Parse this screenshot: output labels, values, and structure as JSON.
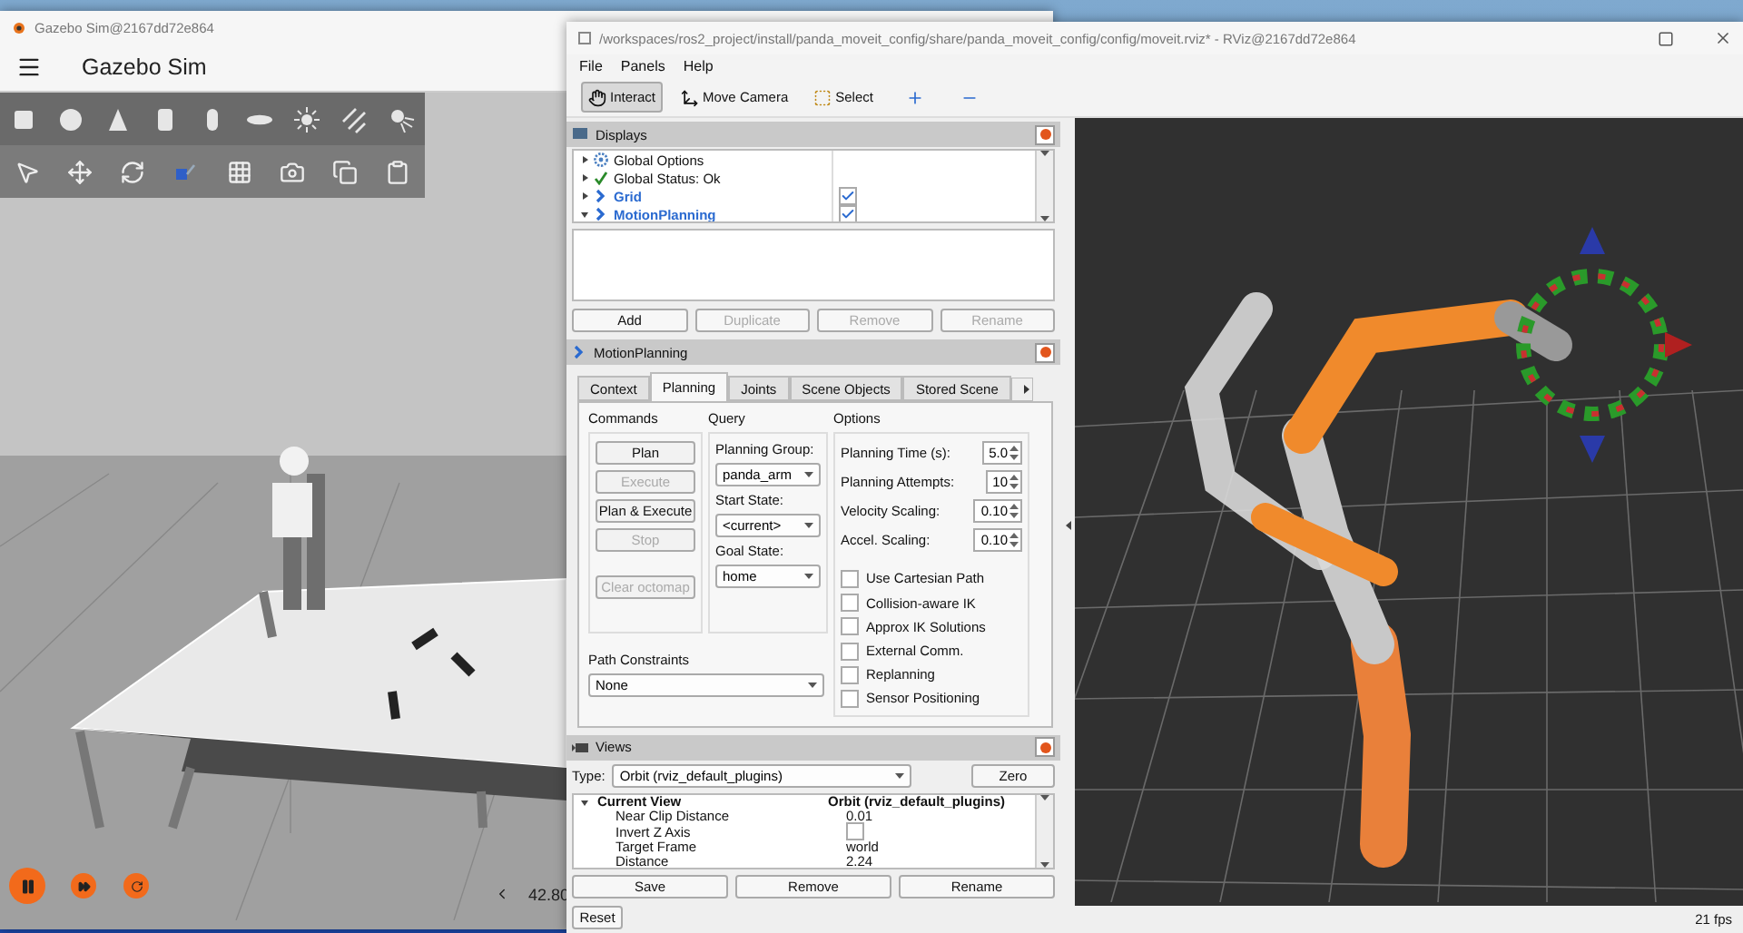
{
  "gazebo": {
    "window_title": "Gazebo Sim@2167dd72e864",
    "app_title": "Gazebo Sim",
    "playing": true,
    "sim_time": "42.80"
  },
  "rviz": {
    "window_title": "/workspaces/ros2_project/install/panda_moveit_config/share/panda_moveit_config/config/moveit.rviz* - RViz@2167dd72e864",
    "menu": [
      "File",
      "Panels",
      "Help"
    ],
    "tools": [
      {
        "label": "Interact",
        "kind": "interact",
        "selected": true
      },
      {
        "label": "Move Camera",
        "kind": "camera",
        "selected": false
      },
      {
        "label": "Select",
        "kind": "select",
        "selected": false
      }
    ],
    "displays": {
      "title": "Displays",
      "items": [
        {
          "label": "Global Options",
          "kind": "options",
          "expanded": false
        },
        {
          "label": "Global Status: Ok",
          "kind": "status",
          "expanded": false
        },
        {
          "label": "Grid",
          "kind": "plugin",
          "expanded": false,
          "checked": true
        },
        {
          "label": "MotionPlanning",
          "kind": "plugin",
          "expanded": true,
          "checked": true
        }
      ],
      "buttons": [
        {
          "label": "Add",
          "disabled": false
        },
        {
          "label": "Duplicate",
          "disabled": true
        },
        {
          "label": "Remove",
          "disabled": true
        },
        {
          "label": "Rename",
          "disabled": true
        }
      ]
    },
    "motion_planning": {
      "title": "MotionPlanning",
      "tabs": [
        {
          "label": "Context",
          "selected": false
        },
        {
          "label": "Planning",
          "selected": true
        },
        {
          "label": "Joints",
          "selected": false
        },
        {
          "label": "Scene Objects",
          "selected": false
        },
        {
          "label": "Stored Scene",
          "selected": false
        }
      ],
      "commands_title": "Commands",
      "commands": [
        {
          "label": "Plan",
          "disabled": false
        },
        {
          "label": "Execute",
          "disabled": true
        },
        {
          "label": "Plan & Execute",
          "disabled": false
        },
        {
          "label": "Stop",
          "disabled": true
        },
        {
          "label": "Clear octomap",
          "disabled": true
        }
      ],
      "query_title": "Query",
      "query": [
        {
          "label": "Planning Group:",
          "value": "panda_arm"
        },
        {
          "label": "Start State:",
          "value": "<current>"
        },
        {
          "label": "Goal State:",
          "value": "home"
        }
      ],
      "options_title": "Options",
      "spinners": [
        {
          "label": "Planning Time (s):",
          "value": "5.0"
        },
        {
          "label": "Planning Attempts:",
          "value": "10"
        },
        {
          "label": "Velocity Scaling:",
          "value": "0.10"
        },
        {
          "label": "Accel. Scaling:",
          "value": "0.10"
        }
      ],
      "checkboxes": [
        {
          "label": "Use Cartesian Path",
          "checked": false
        },
        {
          "label": "Collision-aware IK",
          "checked": false
        },
        {
          "label": "Approx IK Solutions",
          "checked": false
        },
        {
          "label": "External Comm.",
          "checked": false
        },
        {
          "label": "Replanning",
          "checked": false
        },
        {
          "label": "Sensor Positioning",
          "checked": false
        }
      ],
      "path_constraints": {
        "label": "Path Constraints",
        "value": "None"
      }
    },
    "views": {
      "title": "Views",
      "type_label": "Type:",
      "type_value": "Orbit (rviz_default_plugins)",
      "zero": "Zero",
      "properties": [
        {
          "name": "Current View",
          "value": "Orbit (rviz_default_plugins)",
          "kind": "header"
        },
        {
          "name": "Near Clip Distance",
          "value": "0.01",
          "kind": "text"
        },
        {
          "name": "Invert Z Axis",
          "kind": "checkbox",
          "checked": false
        },
        {
          "name": "Target Frame",
          "value": "world",
          "kind": "text"
        },
        {
          "name": "Distance",
          "value": "2.24",
          "kind": "text"
        }
      ],
      "buttons": [
        "Save",
        "Remove",
        "Rename"
      ],
      "reset": "Reset"
    },
    "fps": "21 fps"
  }
}
